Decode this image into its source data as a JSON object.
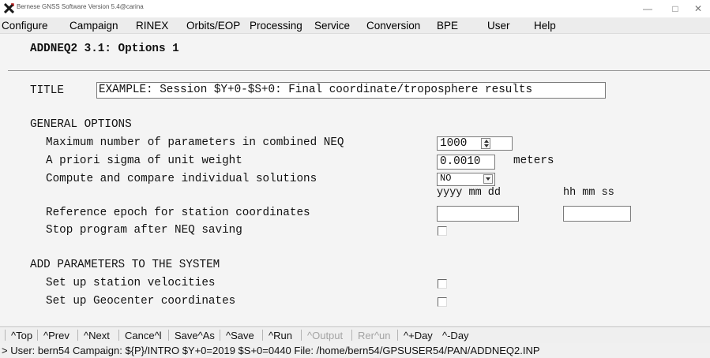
{
  "window": {
    "title": "Bernese GNSS Software Version 5.4@carina",
    "controls": {
      "minimize": "—",
      "maximize": "□",
      "close": "✕"
    }
  },
  "menu": [
    "Configure",
    "Campaign",
    "RINEX",
    "Orbits/EOP",
    "Processing",
    "Service",
    "Conversion",
    "BPE",
    "User",
    "Help"
  ],
  "panel": {
    "heading": "ADDNEQ2 3.1: Options 1",
    "title_label": "TITLE",
    "title_value": "EXAMPLE: Session $Y+0-$S+0: Final coordinate/troposphere results",
    "general_header": "GENERAL OPTIONS",
    "max_params_label": "Maximum number of parameters in combined NEQ",
    "max_params_value": "1000",
    "sigma_label": "A priori sigma of unit weight",
    "sigma_value": "0.0010",
    "sigma_unit": "meters",
    "compute_label": "Compute and compare individual solutions",
    "compute_value": "NO",
    "date_format": "yyyy mm dd",
    "time_format": "hh mm ss",
    "ref_epoch_label": "Reference epoch for station coordinates",
    "ref_epoch_date": "",
    "ref_epoch_time": "",
    "stop_label": "Stop program after NEQ saving",
    "stop_checked": false,
    "add_header": "ADD PARAMETERS TO THE SYSTEM",
    "velocities_label": "Set up station velocities",
    "velocities_checked": false,
    "geocenter_label": "Set up Geocenter coordinates",
    "geocenter_checked": false
  },
  "toolbar": {
    "top": "^Top",
    "prev": "^Prev",
    "next": "^Next",
    "cancel": "Cance^l",
    "saveas": "Save^As",
    "save": "^Save",
    "run": "^Run",
    "output": "^Output",
    "rerun": "Rer^un",
    "plusday": "^+Day",
    "minusday": "^-Day"
  },
  "status": "> User: bern54  Campaign: ${P}/INTRO  $Y+0=2019  $S+0=0440  File: /home/bern54/GPSUSER54/PAN/ADDNEQ2.INP",
  "colors": {
    "app_icon": "#1a1a1a",
    "disabled_text": "#a3a3a3",
    "background": "#f4f4f4"
  }
}
